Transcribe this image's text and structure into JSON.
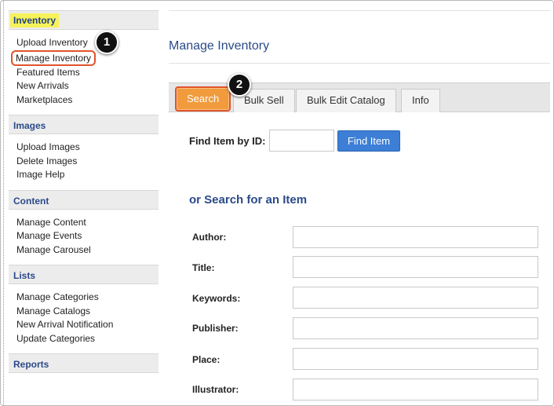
{
  "sidebar": {
    "sections": [
      {
        "title": "Inventory",
        "highlighted": true,
        "items": [
          "Upload Inventory",
          "Manage Inventory",
          "Featured Items",
          "New Arrivals",
          "Marketplaces"
        ]
      },
      {
        "title": "Images",
        "items": [
          "Upload Images",
          "Delete Images",
          "Image Help"
        ]
      },
      {
        "title": "Content",
        "items": [
          "Manage Content",
          "Manage Events",
          "Manage Carousel"
        ]
      },
      {
        "title": "Lists",
        "items": [
          "Manage Categories",
          "Manage Catalogs",
          "New Arrival Notification",
          "Update Categories"
        ]
      },
      {
        "title": "Reports",
        "items": []
      }
    ],
    "circled_item": "Manage Inventory"
  },
  "main": {
    "title": "Manage Inventory",
    "tabs": [
      {
        "label": "Search",
        "active": true
      },
      {
        "label": "Bulk Sell"
      },
      {
        "label": "Bulk Edit Catalog"
      },
      {
        "label": "Info"
      }
    ],
    "find": {
      "label": "Find Item by ID:",
      "value": "",
      "button": "Find Item"
    },
    "search_heading": "or Search for an Item",
    "fields": [
      {
        "label": "Author:",
        "value": ""
      },
      {
        "label": "Title:",
        "value": ""
      },
      {
        "label": "Keywords:",
        "value": ""
      },
      {
        "label": "Publisher:",
        "value": ""
      },
      {
        "label": "Place:",
        "value": ""
      },
      {
        "label": "Illustrator:",
        "value": ""
      }
    ]
  },
  "callouts": [
    "1",
    "2"
  ],
  "colors": {
    "accent": "#2b4a8a",
    "tab_active": "#f19b3c",
    "highlight_border": "#e0542a",
    "button": "#3d7ed6"
  }
}
